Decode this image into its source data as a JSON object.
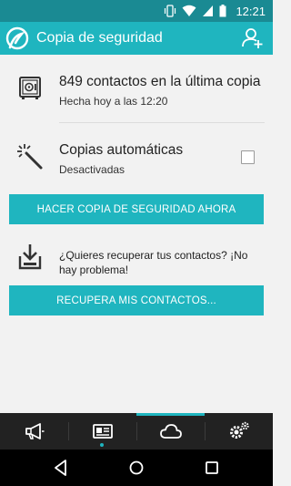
{
  "status_bar": {
    "time": "12:21"
  },
  "app_bar": {
    "title": "Copia de seguridad"
  },
  "last_backup": {
    "title": "849 contactos en la última copia",
    "subtitle": "Hecha hoy a las 12:20"
  },
  "auto_backup": {
    "title": "Copias automáticas",
    "subtitle": "Desactivadas",
    "checked": false
  },
  "backup_now_button": {
    "label": "HACER COPIA DE SEGURIDAD AHORA"
  },
  "recover": {
    "text": "¿Quieres recuperar tus contactos? ¡No hay problema!"
  },
  "recover_button": {
    "label": "RECUPERA MIS CONTACTOS..."
  },
  "bottom_tabs": [
    {
      "icon": "megaphone-icon"
    },
    {
      "icon": "contact-card-icon"
    },
    {
      "icon": "cloud-icon",
      "selected": true
    },
    {
      "icon": "settings-icon"
    }
  ],
  "colors": {
    "accent": "#1fb5bf",
    "status_bar": "#1a8a93",
    "tab_bar": "#222222"
  }
}
